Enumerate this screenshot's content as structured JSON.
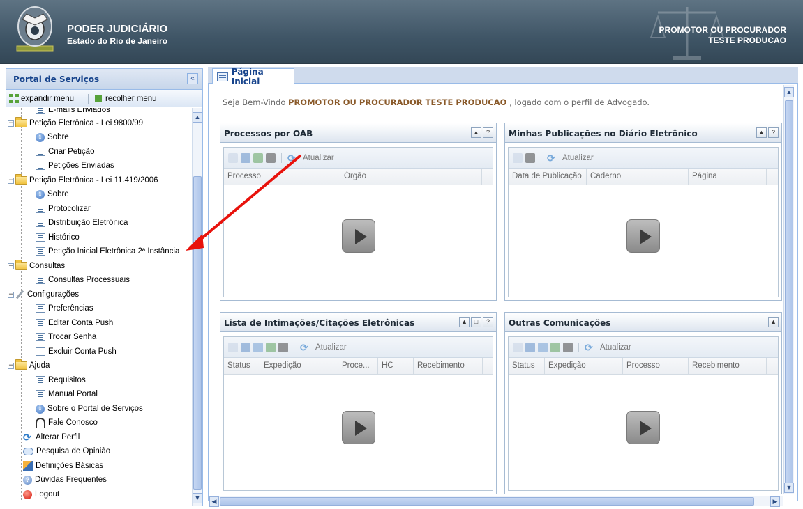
{
  "header": {
    "title": "PODER JUDICIÁRIO",
    "subtitle": "Estado do Rio de Janeiro",
    "user_role": "PROMOTOR OU PROCURADOR",
    "user_name": "TESTE PRODUCAO"
  },
  "sidebar": {
    "title": "Portal de Serviços",
    "collapse_label": "«",
    "expand_label": "expandir menu",
    "collapse_menu_label": "recolher menu",
    "items": [
      {
        "label": "E-mails Enviados",
        "icon": "page-icon"
      },
      {
        "label": "Petição Eletrônica - Lei 9800/99",
        "icon": "folder-icon"
      },
      {
        "label": "Sobre",
        "icon": "info-icon"
      },
      {
        "label": "Criar Petição",
        "icon": "page-icon"
      },
      {
        "label": "Petições Enviadas",
        "icon": "page-icon"
      },
      {
        "label": "Petição Eletrônica - Lei 11.419/2006",
        "icon": "folder-icon"
      },
      {
        "label": "Sobre",
        "icon": "info-icon"
      },
      {
        "label": "Protocolizar",
        "icon": "page-icon"
      },
      {
        "label": "Distribuição Eletrônica",
        "icon": "page-icon"
      },
      {
        "label": "Histórico",
        "icon": "page-icon"
      },
      {
        "label": "Petição Inicial Eletrônica 2ª Instância",
        "icon": "page-icon"
      },
      {
        "label": "Consultas",
        "icon": "folder-icon"
      },
      {
        "label": "Consultas Processuais",
        "icon": "page-icon"
      },
      {
        "label": "Configurações",
        "icon": "wrench-icon"
      },
      {
        "label": "Preferências",
        "icon": "page-icon"
      },
      {
        "label": "Editar Conta Push",
        "icon": "page-icon"
      },
      {
        "label": "Trocar Senha",
        "icon": "page-icon"
      },
      {
        "label": "Excluir Conta Push",
        "icon": "page-icon"
      },
      {
        "label": "Ajuda",
        "icon": "folder-icon"
      },
      {
        "label": "Requisitos",
        "icon": "page-icon"
      },
      {
        "label": "Manual Portal",
        "icon": "page-icon"
      },
      {
        "label": "Sobre o Portal de Serviços",
        "icon": "info-icon"
      },
      {
        "label": "Fale Conosco",
        "icon": "headset-icon"
      },
      {
        "label": "Alterar Perfil",
        "icon": "refresh-icon"
      },
      {
        "label": "Pesquisa de Opinião",
        "icon": "speech-bubble-icon"
      },
      {
        "label": "Definições Básicas",
        "icon": "pencil-icon"
      },
      {
        "label": "Dúvidas Frequentes",
        "icon": "question-icon"
      },
      {
        "label": "Logout",
        "icon": "logout-icon"
      }
    ]
  },
  "main": {
    "tab_label": "Página Inicial",
    "welcome_prefix": "Seja Bem-Vindo ",
    "welcome_user": "PROMOTOR OU PROCURADOR TESTE PRODUCAO",
    "welcome_suffix": " , logado com o perfil de Advogado.",
    "refresh_label": "Atualizar",
    "portlets": [
      {
        "title": "Processos por OAB",
        "columns": [
          "Processo",
          "Órgão"
        ]
      },
      {
        "title": "Minhas Publicações no Diário Eletrônico",
        "columns": [
          "Data de Publicação",
          "Caderno",
          "Página"
        ]
      },
      {
        "title": "Lista de Intimações/Citações Eletrônicas",
        "columns": [
          "Status",
          "Expedição",
          "Proce...",
          "HC",
          "Recebimento"
        ]
      },
      {
        "title": "Outras Comunicações",
        "columns": [
          "Status",
          "Expedição",
          "Processo",
          "Recebimento"
        ]
      }
    ]
  },
  "colors": {
    "header_bg": "#3f5566",
    "panel_title": "#15428b",
    "annotation_arrow": "#e8120c"
  }
}
